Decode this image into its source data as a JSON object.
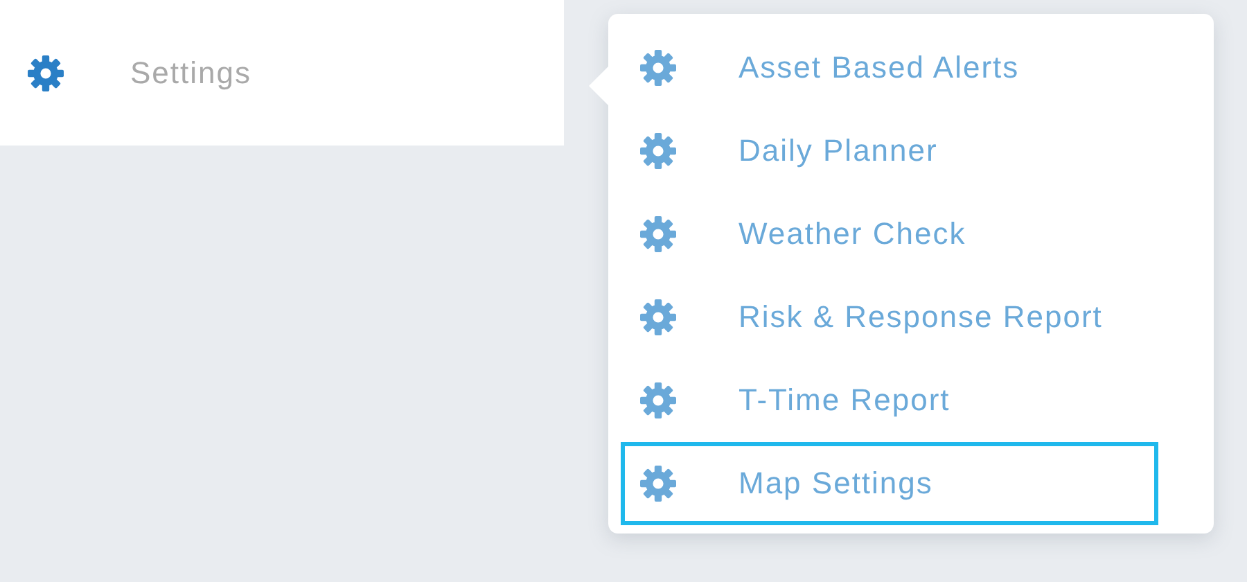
{
  "sidebar": {
    "items": [
      {
        "label": "Settings",
        "selected": true
      }
    ]
  },
  "menu": {
    "items": [
      {
        "label": "Asset Based Alerts",
        "selected": false
      },
      {
        "label": "Daily Planner",
        "selected": false
      },
      {
        "label": "Weather Check",
        "selected": false
      },
      {
        "label": "Risk & Response Report",
        "selected": false
      },
      {
        "label": "T-Time Report",
        "selected": false
      },
      {
        "label": "Map Settings",
        "selected": true
      }
    ]
  }
}
